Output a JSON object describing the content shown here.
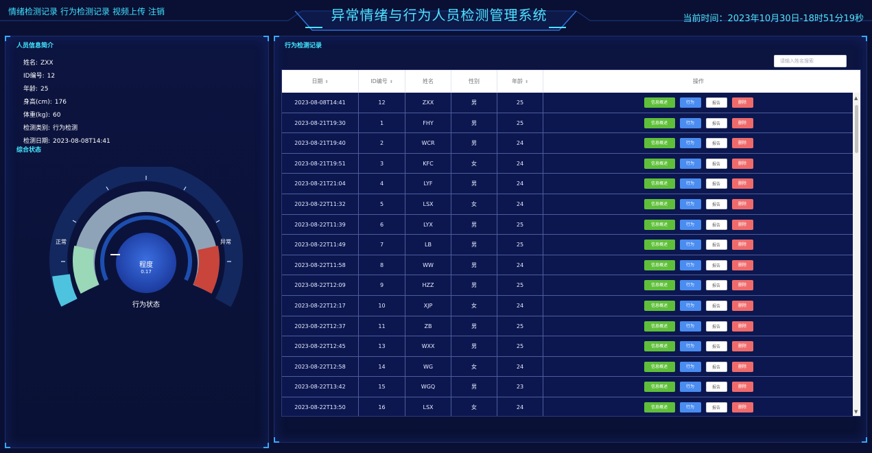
{
  "nav": {
    "links": [
      "情绪检测记录",
      "行为检测记录",
      "视频上传",
      "注销"
    ]
  },
  "header": {
    "title": "异常情绪与行为人员检测管理系统",
    "clock_label": "当前时间：",
    "clock_value": "2023年10月30日-18时51分19秒"
  },
  "left": {
    "profile_title": "人员信息简介",
    "profile": [
      {
        "k": "姓名:",
        "v": "ZXX"
      },
      {
        "k": "ID编号:",
        "v": "12"
      },
      {
        "k": "年龄:",
        "v": "25"
      },
      {
        "k": "身高(cm):",
        "v": "176"
      },
      {
        "k": "体重(kg):",
        "v": "60"
      },
      {
        "k": "检测类别:",
        "v": "行为检测"
      },
      {
        "k": "检测日期:",
        "v": "2023-08-08T14:41"
      }
    ],
    "status_title": "综合状态",
    "gauge": {
      "left_label": "正常",
      "right_label": "异常",
      "center_label": "程度",
      "value": "0.17",
      "value_fraction": 0.17,
      "bottom_label": "行为状态",
      "colors": {
        "low": "#9ad8b7",
        "mid": "#8fa3b8",
        "high": "#c9443a",
        "outer_left": "#4ec3e0"
      }
    }
  },
  "right": {
    "title": "行为检测记录",
    "search_placeholder": "请输入姓名搜索",
    "columns": [
      "日期",
      "ID编号",
      "姓名",
      "性别",
      "年龄",
      "操作"
    ],
    "buttons": {
      "info": "信息概述",
      "action": "行为",
      "report": "报告",
      "delete": "删除"
    },
    "rows": [
      {
        "date": "2023-08-08T14:41",
        "id": "12",
        "name": "ZXX",
        "sex": "男",
        "age": "25"
      },
      {
        "date": "2023-08-21T19:30",
        "id": "1",
        "name": "FHY",
        "sex": "男",
        "age": "25"
      },
      {
        "date": "2023-08-21T19:40",
        "id": "2",
        "name": "WCR",
        "sex": "男",
        "age": "24"
      },
      {
        "date": "2023-08-21T19:51",
        "id": "3",
        "name": "KFC",
        "sex": "女",
        "age": "24"
      },
      {
        "date": "2023-08-21T21:04",
        "id": "4",
        "name": "LYF",
        "sex": "男",
        "age": "24"
      },
      {
        "date": "2023-08-22T11:32",
        "id": "5",
        "name": "LSX",
        "sex": "女",
        "age": "24"
      },
      {
        "date": "2023-08-22T11:39",
        "id": "6",
        "name": "LYX",
        "sex": "男",
        "age": "25"
      },
      {
        "date": "2023-08-22T11:49",
        "id": "7",
        "name": "LB",
        "sex": "男",
        "age": "25"
      },
      {
        "date": "2023-08-22T11:58",
        "id": "8",
        "name": "WW",
        "sex": "男",
        "age": "24"
      },
      {
        "date": "2023-08-22T12:09",
        "id": "9",
        "name": "HZZ",
        "sex": "男",
        "age": "25"
      },
      {
        "date": "2023-08-22T12:17",
        "id": "10",
        "name": "XJP",
        "sex": "女",
        "age": "24"
      },
      {
        "date": "2023-08-22T12:37",
        "id": "11",
        "name": "ZB",
        "sex": "男",
        "age": "25"
      },
      {
        "date": "2023-08-22T12:45",
        "id": "13",
        "name": "WXX",
        "sex": "男",
        "age": "25"
      },
      {
        "date": "2023-08-22T12:58",
        "id": "14",
        "name": "WG",
        "sex": "女",
        "age": "24"
      },
      {
        "date": "2023-08-22T13:42",
        "id": "15",
        "name": "WGQ",
        "sex": "男",
        "age": "23"
      },
      {
        "date": "2023-08-22T13:50",
        "id": "16",
        "name": "LSX",
        "sex": "女",
        "age": "24"
      }
    ]
  }
}
